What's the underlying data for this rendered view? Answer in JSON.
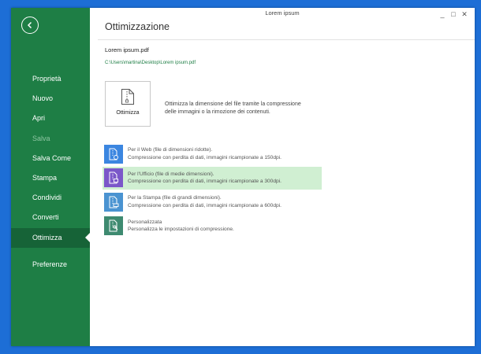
{
  "window": {
    "title": "Lorem ipsum",
    "controls": [
      "_",
      "□",
      "✕"
    ]
  },
  "sidebar": {
    "items": [
      {
        "label": "Proprietà",
        "state": "normal"
      },
      {
        "label": "Nuovo",
        "state": "normal"
      },
      {
        "label": "Apri",
        "state": "normal"
      },
      {
        "label": "Salva",
        "state": "disabled"
      },
      {
        "label": "Salva Come",
        "state": "normal"
      },
      {
        "label": "Stampa",
        "state": "normal"
      },
      {
        "label": "Condividi",
        "state": "normal"
      },
      {
        "label": "Converti",
        "state": "normal"
      },
      {
        "label": "Ottimizza",
        "state": "active"
      },
      {
        "label": "Preferenze",
        "state": "normal"
      }
    ]
  },
  "main": {
    "title": "Ottimizzazione",
    "file_name": "Lorem ipsum.pdf",
    "file_path": "C:\\Users\\martina\\Desktop\\Lorem ipsum.pdf",
    "optimize_button": {
      "label": "Ottimizza"
    },
    "description_line1": "Ottimizza la dimensione del file tramite la compressione",
    "description_line2": "delle immagini o la rimozione dei contenuti.",
    "options": [
      {
        "title": "Per il Web (file di dimensioni ridotte).",
        "detail": "Compressione con perdita di dati, immagini ricampionate a 150dpi.",
        "color": "#3b86e0",
        "selected": false
      },
      {
        "title": "Per l'Ufficio (file di medie dimensioni).",
        "detail": "Compressione con perdita di dati, immagini ricampionate a 300dpi.",
        "color": "#7b57c9",
        "selected": true
      },
      {
        "title": "Per la Stampa (file di grandi dimensioni).",
        "detail": "Compressione con perdita di dati, immagini ricampionate a 600dpi.",
        "color": "#4a93d1",
        "selected": false
      },
      {
        "title": "Personalizzata",
        "detail": "Personalizza le impostazioni di compressione.",
        "color": "#3e8a70",
        "selected": false
      }
    ]
  },
  "colors": {
    "sidebar_bg": "#1e7e45",
    "sidebar_active": "#166337",
    "desktop_bg": "#1d6ed6",
    "selected_option_bg": "#d0efd2"
  }
}
